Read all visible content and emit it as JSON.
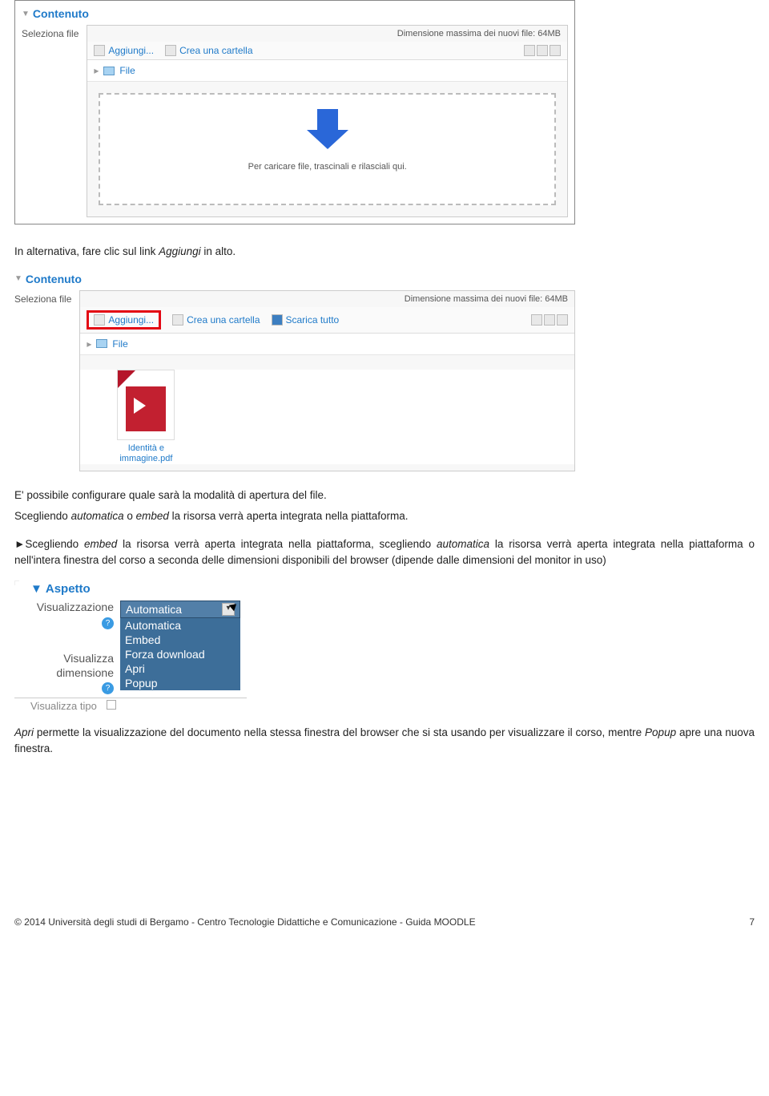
{
  "shot1": {
    "section": "Contenuto",
    "row_label": "Seleziona file",
    "maxsize": "Dimensione massima dei nuovi file: 64MB",
    "add": "Aggiungi...",
    "create_folder": "Crea una cartella",
    "breadcrumb": "File",
    "drop_text": "Per caricare file, trascinali e rilasciali qui."
  },
  "para1": {
    "pre": "In alternativa, fare clic sul link ",
    "it": "Aggiungi",
    "post": " in alto."
  },
  "shot2": {
    "section": "Contenuto",
    "row_label": "Seleziona file",
    "maxsize": "Dimensione massima dei nuovi file: 64MB",
    "add": "Aggiungi...",
    "create_folder": "Crea una cartella",
    "download_all": "Scarica tutto",
    "breadcrumb": "File",
    "pdf_label_1": "Identità e",
    "pdf_label_2": "immagine.pdf"
  },
  "para2": "E' possibile configurare quale sarà la modalità di apertura del file.",
  "para3": {
    "pre": "Scegliendo ",
    "a": "automatica",
    "mid1": " o ",
    "b": "embed",
    "post": " la risorsa verrà aperta integrata nella piattaforma."
  },
  "para4": {
    "t1": "►Scegliendo ",
    "t2": "embed",
    "t3": " la risorsa verrà aperta integrata nella piattaforma, scegliendo ",
    "t4": "automatica",
    "t5": " la risorsa verrà aperta integrata nella piattaforma o nell'intera finestra del corso a seconda delle dimensioni disponibili del browser (dipende dalle dimensioni del monitor in uso)"
  },
  "shot3": {
    "section": "Aspetto",
    "label1": "Visualizzazione",
    "label2_a": "Visualizza",
    "label2_b": "dimensione",
    "label3": "Visualizza tipo",
    "current": "Automatica",
    "options": [
      "Automatica",
      "Embed",
      "Forza download",
      "Apri",
      "Popup"
    ]
  },
  "para5": {
    "t1": "Apri",
    "t2": " permette la visualizzazione del documento nella stessa finestra del browser che si sta usando per visualizzare il corso, mentre ",
    "t3": "Popup",
    "t4": " apre una nuova finestra."
  },
  "footer": {
    "left": "© 2014 Università degli studi di Bergamo - Centro Tecnologie Didattiche e Comunicazione - Guida MOODLE",
    "page": "7"
  }
}
